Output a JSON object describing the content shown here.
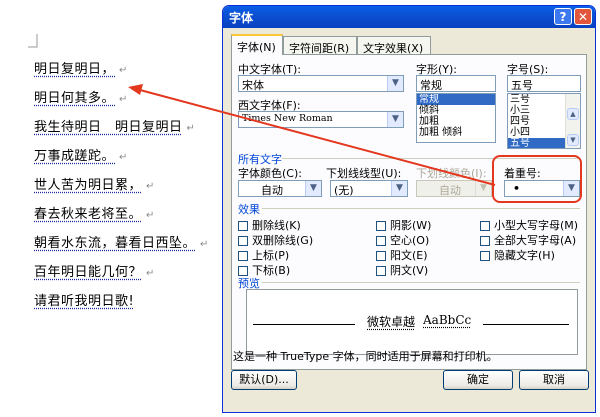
{
  "poem": {
    "lines": [
      "明日复明日，",
      "明日何其多。",
      "我生待明日　明日复明日",
      "万事成蹉跎。",
      "世人苦为明日累，",
      "春去秋来老将至。",
      "朝看水东流，暮看日西坠。",
      "百年明日能几何？",
      "请君听我明日歌!"
    ],
    "para_mark": "↵"
  },
  "dialog": {
    "title": "字体",
    "help_glyph": "?",
    "close_glyph": "✕",
    "tabs": [
      "字体(N)",
      "字符间距(R)",
      "文字效果(X)"
    ],
    "cn_font_label": "中文字体(T):",
    "cn_font_value": "宋体",
    "latin_font_label": "西文字体(F):",
    "latin_font_value": "Times New Roman",
    "style_label": "字形(Y):",
    "style_value": "常规",
    "style_items": [
      "常规",
      "倾斜",
      "加粗",
      "加粗 倾斜"
    ],
    "size_label": "字号(S):",
    "size_value": "五号",
    "size_items": [
      "三号",
      "小三",
      "四号",
      "小四",
      "五号"
    ],
    "all_text_title": "所有文字",
    "color_label": "字体颜色(C):",
    "color_value": "自动",
    "underline_label": "下划线线型(U):",
    "underline_value": "(无)",
    "underline_color_label": "下划线颜色(I):",
    "underline_color_value": "自动",
    "emphasis_label": "着重号:",
    "emphasis_value": "•",
    "effects_title": "效果",
    "effects": [
      [
        "删除线(K)",
        "双删除线(G)",
        "上标(P)",
        "下标(B)"
      ],
      [
        "阴影(W)",
        "空心(O)",
        "阳文(E)",
        "阴文(V)"
      ],
      [
        "小型大写字母(M)",
        "全部大写字母(A)",
        "隐藏文字(H)"
      ]
    ],
    "preview_title": "预览",
    "preview_text_cn": "微软卓越",
    "preview_text_latin": "AaBbCc",
    "info_text": "这是一种 TrueType 字体，同时适用于屏幕和打印机。",
    "default_button": "默认(D)...",
    "ok_button": "确定",
    "cancel_button": "取消",
    "dropdown_glyph": "▼",
    "up_glyph": "▲"
  },
  "colors": {
    "highlight": "#e3371e",
    "title_bar": "#0a5fe8",
    "group_title": "#0046d5"
  }
}
